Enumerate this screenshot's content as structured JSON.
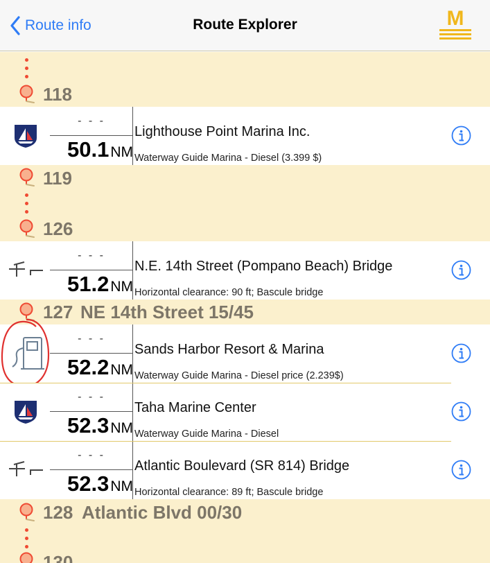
{
  "nav": {
    "back_label": "Route info",
    "title": "Route Explorer",
    "logo_letter": "M"
  },
  "colors": {
    "accent": "#2f7cf6",
    "band": "#fbf0cd",
    "waypoint_text": "#7d7668",
    "pin": "#ef4a33",
    "logo": "#f0b71c",
    "annotation_circle": "#e0312f"
  },
  "waypoints": {
    "wp118": {
      "number": "118",
      "name": ""
    },
    "wp119": {
      "number": "119",
      "name": ""
    },
    "wp126": {
      "number": "126",
      "name": ""
    },
    "wp127": {
      "number": "127",
      "name": "NE 14th Street 15/45"
    },
    "wp128": {
      "number": "128",
      "name": "Atlantic Blvd 00/30"
    },
    "wp130": {
      "number": "130",
      "name": ""
    }
  },
  "items": [
    {
      "icon": "marina-sailboat-icon",
      "dashes": "- - -",
      "distance": "50.1",
      "unit": "NM",
      "title": "Lighthouse Point Marina Inc.",
      "subtitle": "Waterway Guide Marina - Diesel (3.399 $)"
    },
    {
      "icon": "bridge-icon",
      "dashes": "- - -",
      "distance": "51.2",
      "unit": "NM",
      "title": "N.E. 14th Street (Pompano Beach) Bridge",
      "subtitle": "Horizontal clearance: 90 ft; Bascule bridge"
    },
    {
      "icon": "fuel-pump-icon",
      "dashes": "- - -",
      "distance": "52.2",
      "unit": "NM",
      "title": "Sands Harbor Resort & Marina",
      "subtitle": "Waterway Guide Marina - Diesel price (2.239$)"
    },
    {
      "icon": "marina-sailboat-icon",
      "dashes": "- - -",
      "distance": "52.3",
      "unit": "NM",
      "title": "Taha Marine Center",
      "subtitle": "Waterway Guide Marina - Diesel"
    },
    {
      "icon": "bridge-icon",
      "dashes": "- - -",
      "distance": "52.3",
      "unit": "NM",
      "title": "Atlantic Boulevard (SR 814) Bridge",
      "subtitle": "Horizontal clearance: 89 ft; Bascule bridge"
    }
  ]
}
